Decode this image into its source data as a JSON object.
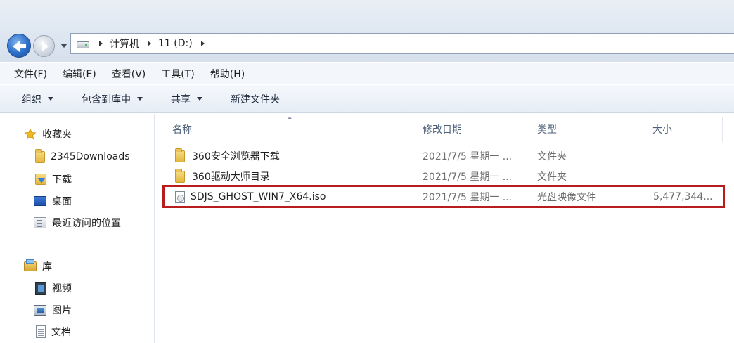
{
  "address_bar": {
    "breadcrumbs": [
      "计算机",
      "11 (D:)"
    ]
  },
  "menubar": {
    "items": [
      "文件(F)",
      "编辑(E)",
      "查看(V)",
      "工具(T)",
      "帮助(H)"
    ]
  },
  "toolbar": {
    "organize": "组织",
    "include_in_library": "包含到库中",
    "share": "共享",
    "new_folder": "新建文件夹"
  },
  "navpane": {
    "favorites": {
      "label": "收藏夹",
      "items": [
        "2345Downloads",
        "下载",
        "桌面",
        "最近访问的位置"
      ]
    },
    "libraries": {
      "label": "库",
      "items": [
        "视频",
        "图片",
        "文档"
      ]
    }
  },
  "filelist": {
    "columns": {
      "name": "名称",
      "modified": "修改日期",
      "type": "类型",
      "size": "大小"
    },
    "rows": [
      {
        "name": "360安全浏览器下载",
        "modified": "2021/7/5 星期一 ...",
        "type": "文件夹",
        "size": "",
        "icon": "folder-icon"
      },
      {
        "name": "360驱动大师目录",
        "modified": "2021/7/5 星期一 ...",
        "type": "文件夹",
        "size": "",
        "icon": "folder-icon"
      },
      {
        "name": "SDJS_GHOST_WIN7_X64.iso",
        "modified": "2021/7/5 星期一 ...",
        "type": "光盘映像文件",
        "size": "5,477,344...",
        "icon": "disc-image-icon",
        "highlighted": true
      }
    ]
  },
  "colors": {
    "highlight_border": "#b81c1c",
    "nav_back": "#2d6fc7"
  }
}
